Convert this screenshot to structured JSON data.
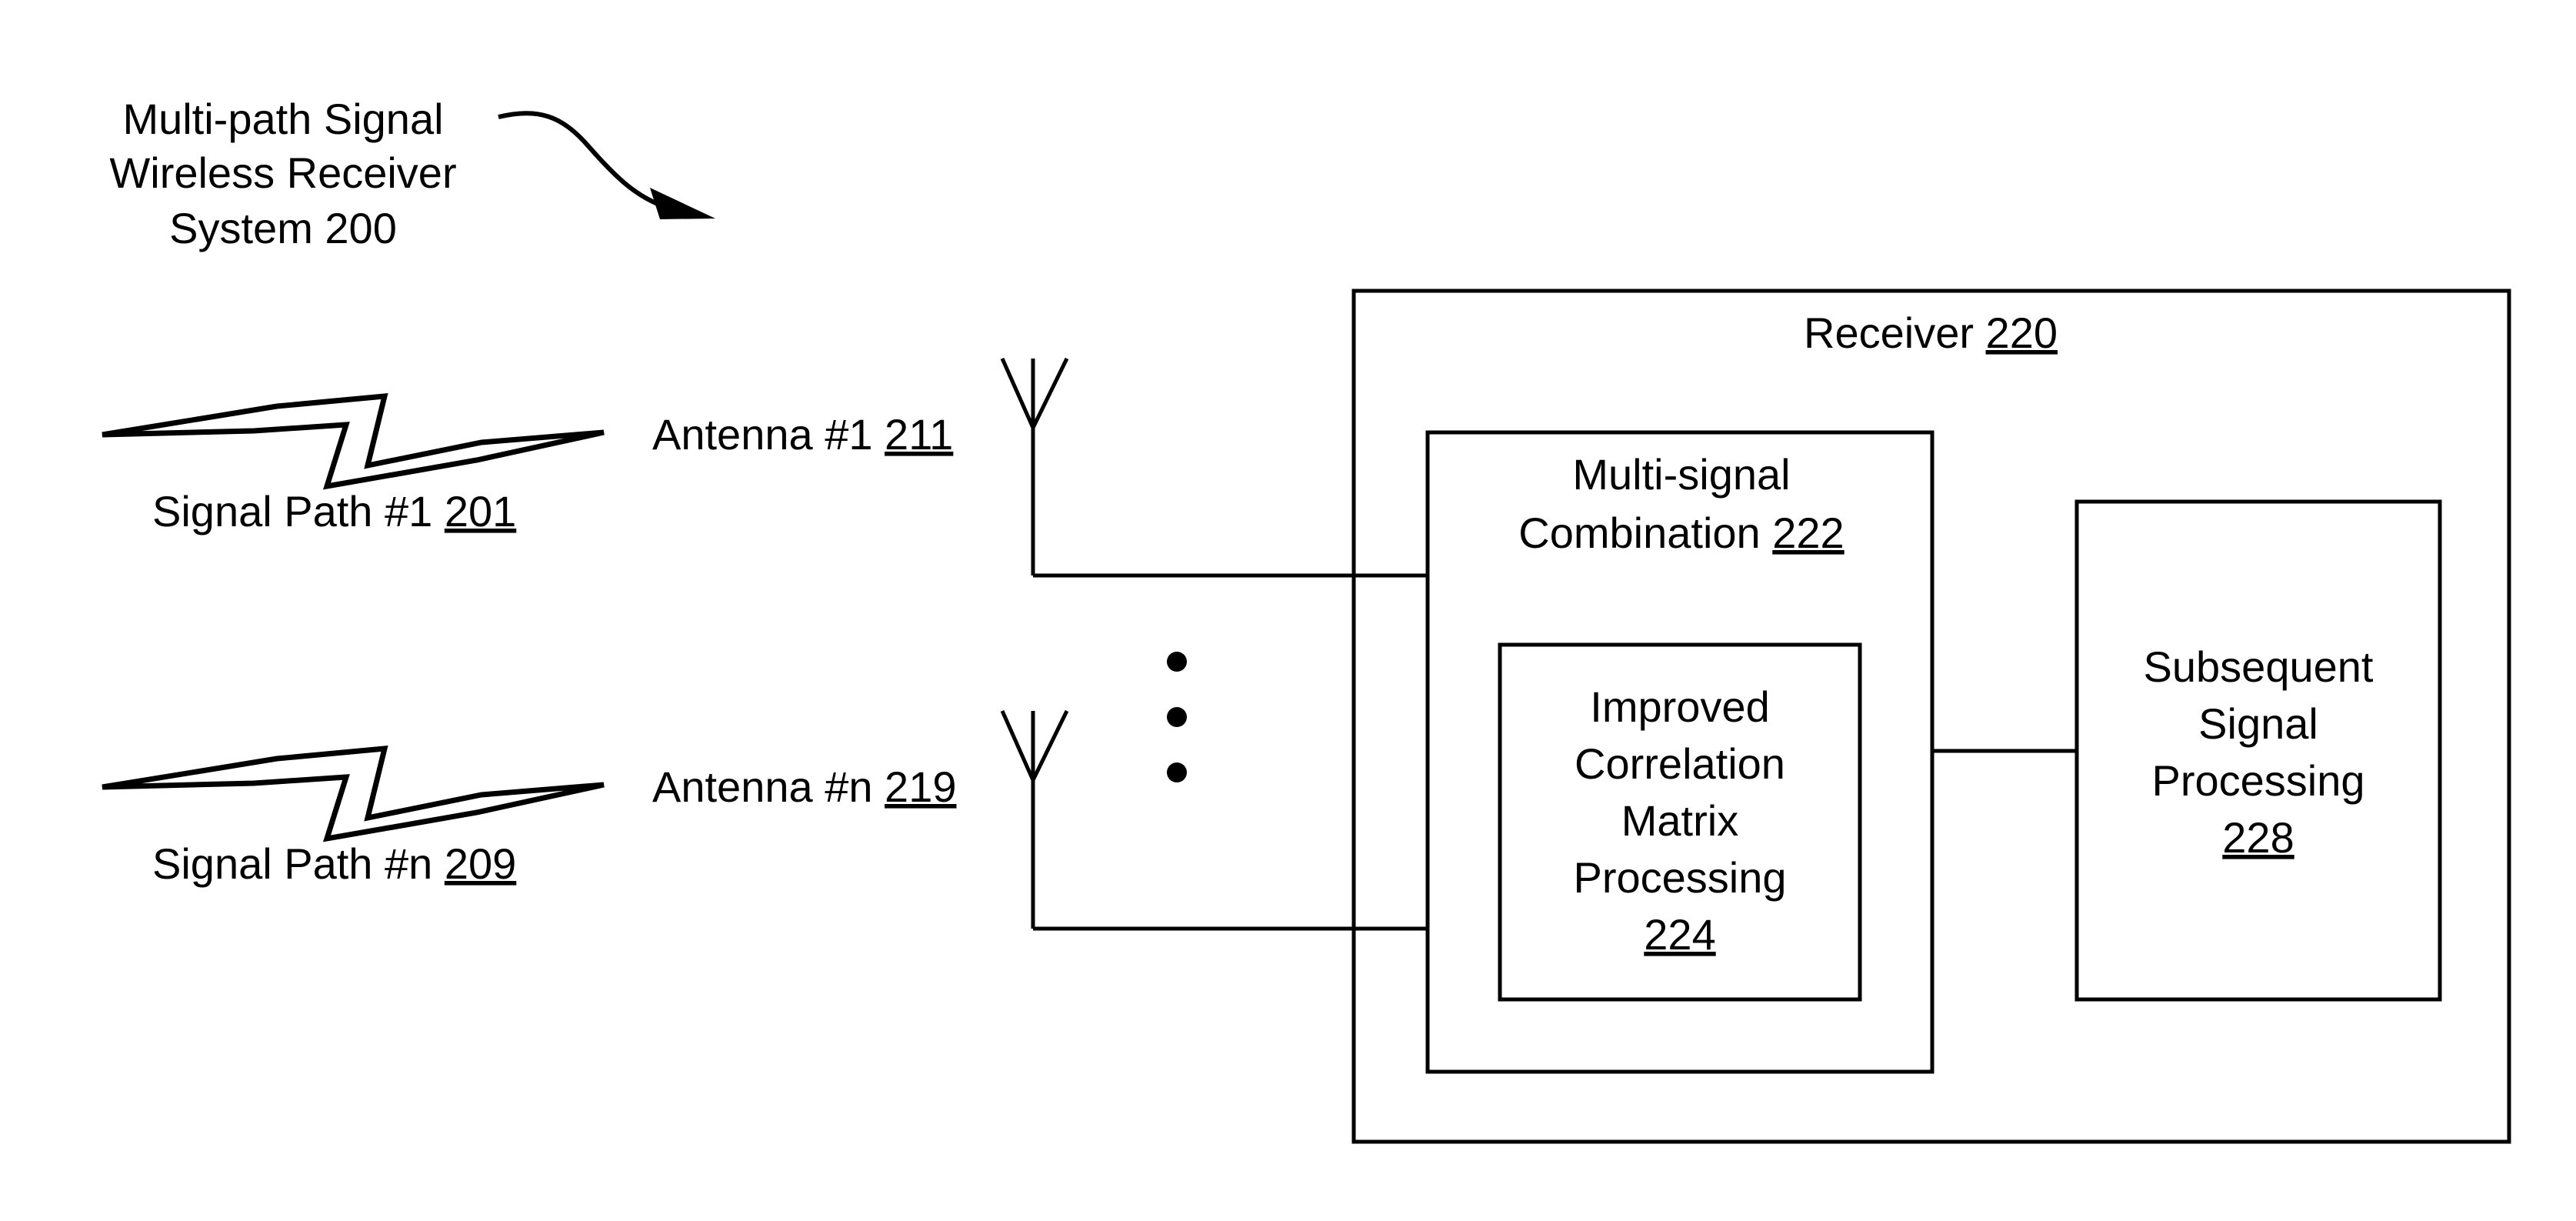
{
  "title": {
    "lines": [
      "Multi-path Signal",
      "Wireless Receiver",
      "System 200"
    ]
  },
  "signal_paths": [
    {
      "label": "Signal Path #1",
      "ref": "201"
    },
    {
      "label": "Signal Path #n",
      "ref": "209"
    }
  ],
  "antennas": [
    {
      "label": "Antenna #1",
      "ref": "211"
    },
    {
      "label": "Antenna #n",
      "ref": "219"
    }
  ],
  "receiver": {
    "label": "Receiver",
    "ref": "220"
  },
  "multi_signal": {
    "lines": [
      "Multi-signal",
      "Combination"
    ],
    "ref": "222"
  },
  "improved": {
    "lines": [
      "Improved",
      "Correlation",
      "Matrix",
      "Processing"
    ],
    "ref": "224"
  },
  "subsequent": {
    "lines": [
      "Subsequent",
      "Signal",
      "Processing"
    ],
    "ref": "228"
  },
  "colors": {
    "stroke": "#000000",
    "background": "#ffffff"
  }
}
